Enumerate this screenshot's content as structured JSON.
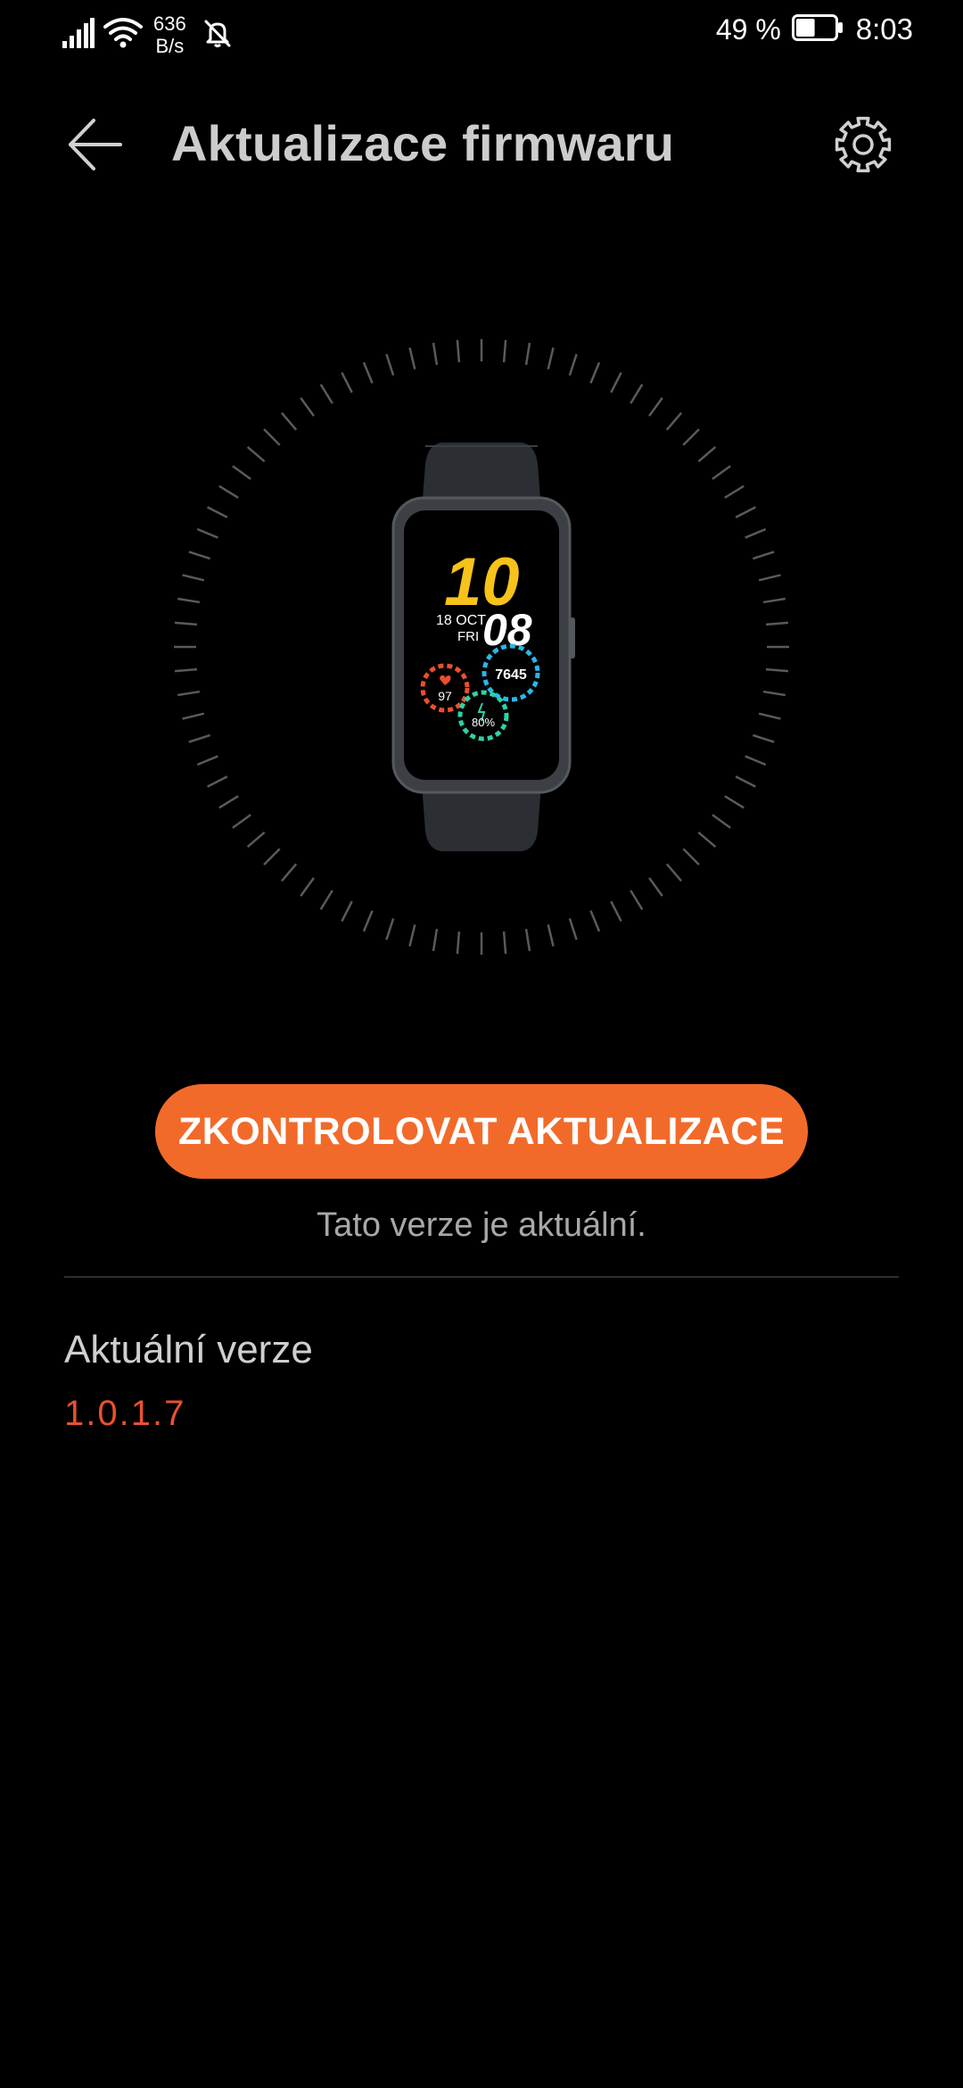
{
  "status_bar": {
    "net_speed_value": "636",
    "net_speed_unit": "B/s",
    "battery_percent": "49 %",
    "battery_level": 0.49,
    "time": "8:03",
    "icons": [
      "signal-icon",
      "wifi-icon",
      "bell-off-icon",
      "battery-icon"
    ]
  },
  "header": {
    "title": "Aktualizace firmwaru",
    "back_icon": "arrow-left-icon",
    "settings_icon": "gear-icon"
  },
  "watch_face": {
    "hour": "10",
    "minute": "08",
    "date": "18 OCT",
    "weekday": "FRI",
    "steps": "7645",
    "heart_rate": "97",
    "battery": "80%"
  },
  "main": {
    "check_button_label": "ZKONTROLOVAT AKTUALIZACE",
    "status_text": "Tato verze je aktuální.",
    "version_label": "Aktuální verze",
    "version_value": "1.0.1.7"
  },
  "colors": {
    "accent": "#f26a2a",
    "version_text": "#e8512f",
    "background": "#000000",
    "watch_hour": "#f7c21a",
    "ring_steps": "#2ab7e8",
    "ring_heart": "#e8512f",
    "ring_battery": "#2fd1a6"
  }
}
